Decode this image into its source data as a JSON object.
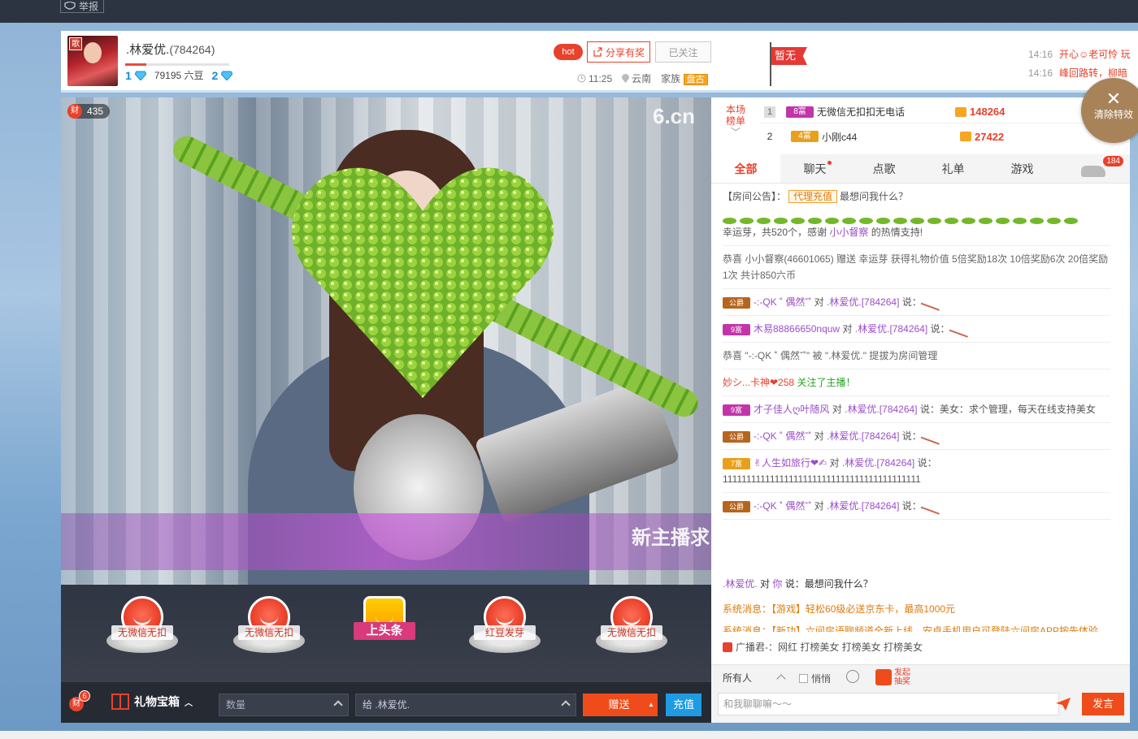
{
  "topbar": {
    "report_label": "举报"
  },
  "header": {
    "host_name": ".林爱优.",
    "host_id": "(784264)",
    "avatar_badge": "歌",
    "level_left": "1",
    "beans_text": "79195 六豆",
    "level_right": "2",
    "hot_label": "hot",
    "share_label": "分享有奖",
    "follow_label": "已关注",
    "time": "11:25",
    "location": "云南",
    "family_label": "家族",
    "family_tag": "盘古",
    "flag_label": "暂无",
    "news": [
      {
        "time": "14:16",
        "msg": "开心☺老可怜 玩"
      },
      {
        "time": "14:16",
        "msg": "峰回路转，柳暗"
      }
    ]
  },
  "video": {
    "fans_badge": "财",
    "fans_count": "435",
    "logo": "6.cn",
    "banner_text": "新主播求"
  },
  "gifts": [
    {
      "label": "无微信无扣"
    },
    {
      "label": "无微信无扣"
    },
    {
      "label": "上头条"
    },
    {
      "label": "红豆发芽"
    },
    {
      "label": "无微信无扣"
    }
  ],
  "bottom": {
    "cai_label": "财",
    "cai_count": "6",
    "treasure_label": "礼物宝箱",
    "qty_placeholder": "数量",
    "to_label": "给 .林爱优.",
    "send_label": "赠送",
    "recharge_label": "充值"
  },
  "ranking": {
    "side_title_1": "本场",
    "side_title_2": "榜单",
    "rows": [
      {
        "rank": "1",
        "badge": "8富",
        "name": "无微信无扣扣无电话",
        "score": "148264"
      },
      {
        "rank": "2",
        "badge": "4富",
        "name": "小刚c44",
        "score": "27422"
      }
    ]
  },
  "clear_fx": {
    "icon": "✕",
    "label": "清除特效"
  },
  "tabs": [
    {
      "label": "全部"
    },
    {
      "label": "聊天"
    },
    {
      "label": "点歌"
    },
    {
      "label": "礼单"
    },
    {
      "label": "游戏"
    }
  ],
  "car_badge": "184",
  "chat": {
    "notice_prefix": "【房间公告】：",
    "notice_tag": "代理充值",
    "notice_text": "最想问我什么？",
    "lucky_text_1": "幸运芽，共520个，感谢",
    "lucky_user": "小小督察",
    "lucky_text_2": "的热情支持!",
    "reward_text": "恭喜 小小督察(46601065) 赠送 幸运芽 获得礼物价值 5倍奖励18次 10倍奖励6次 20倍奖励1次 共计850六币",
    "m1_badge": "公爵",
    "m1_user": "-:-QK ˚ 偶然ˇ˚",
    "m1_to": "对",
    "m1_target": ".林爱优.[784264]",
    "m1_say": "说：",
    "m2_badge": "9富",
    "m2_user": "木易88866650nquw",
    "m2_to": "对",
    "m2_target": ".林爱优.[784264]",
    "m2_say": "说：",
    "admin_text": "恭喜 \"-:-QK ˚ 偶然ˇ˚\" 被 \".林爱优.\" 提拔为房间管理",
    "follow_user": "妙シ...卡神❤258",
    "follow_text": "关注了主播！",
    "m3_badge": "9富",
    "m3_user": "才子佳人ღ叶随风",
    "m3_to": "对",
    "m3_target": ".林爱优.[784264]",
    "m3_say": "说：美女：求个管理，每天在线支持美女",
    "m4_badge": "公爵",
    "m4_user": "-:-QK ˚ 偶然ˇ˚",
    "m4_to": "对",
    "m4_target": ".林爱优.[784264]",
    "m4_say": "说：",
    "m5_badge": "7富",
    "m5_user": "✌人生如旅行❤✍",
    "m5_to": "对",
    "m5_target": ".林爱优.[784264]",
    "m5_say": "说：111111111111111111111111111111111111111111",
    "m6_badge": "公爵",
    "m6_user": "-:-QK ˚ 偶然ˇ˚",
    "m6_to": "对",
    "m6_target": ".林爱优.[784264]",
    "m6_say": "说："
  },
  "sysmsgs": {
    "host_user": ".林爱优.",
    "host_to": "对",
    "host_target": "你",
    "host_say": "说：最想问我什么？",
    "sys1_prefix": "系统消息：",
    "sys1_text": "【游戏】轻松60级必送京东卡，最高1000元",
    "sys2_prefix": "系统消息：",
    "sys2_text": "【新功】六间房语聊频道全新上线，安卓手机用户可登陆六间房APP按先体验"
  },
  "broadcast": {
    "text": "广播君-：网红 打榜美女 打榜美女 打榜美女"
  },
  "input": {
    "target": "所有人",
    "private_label": "悄悄",
    "vote_line1": "发起",
    "vote_line2": "抽奖",
    "placeholder": "和我聊聊嘛～～",
    "speak_label": "发言"
  },
  "colors": {
    "accent": "#e8412c",
    "blue": "#1e9be3",
    "purple": "#9b4dca"
  }
}
